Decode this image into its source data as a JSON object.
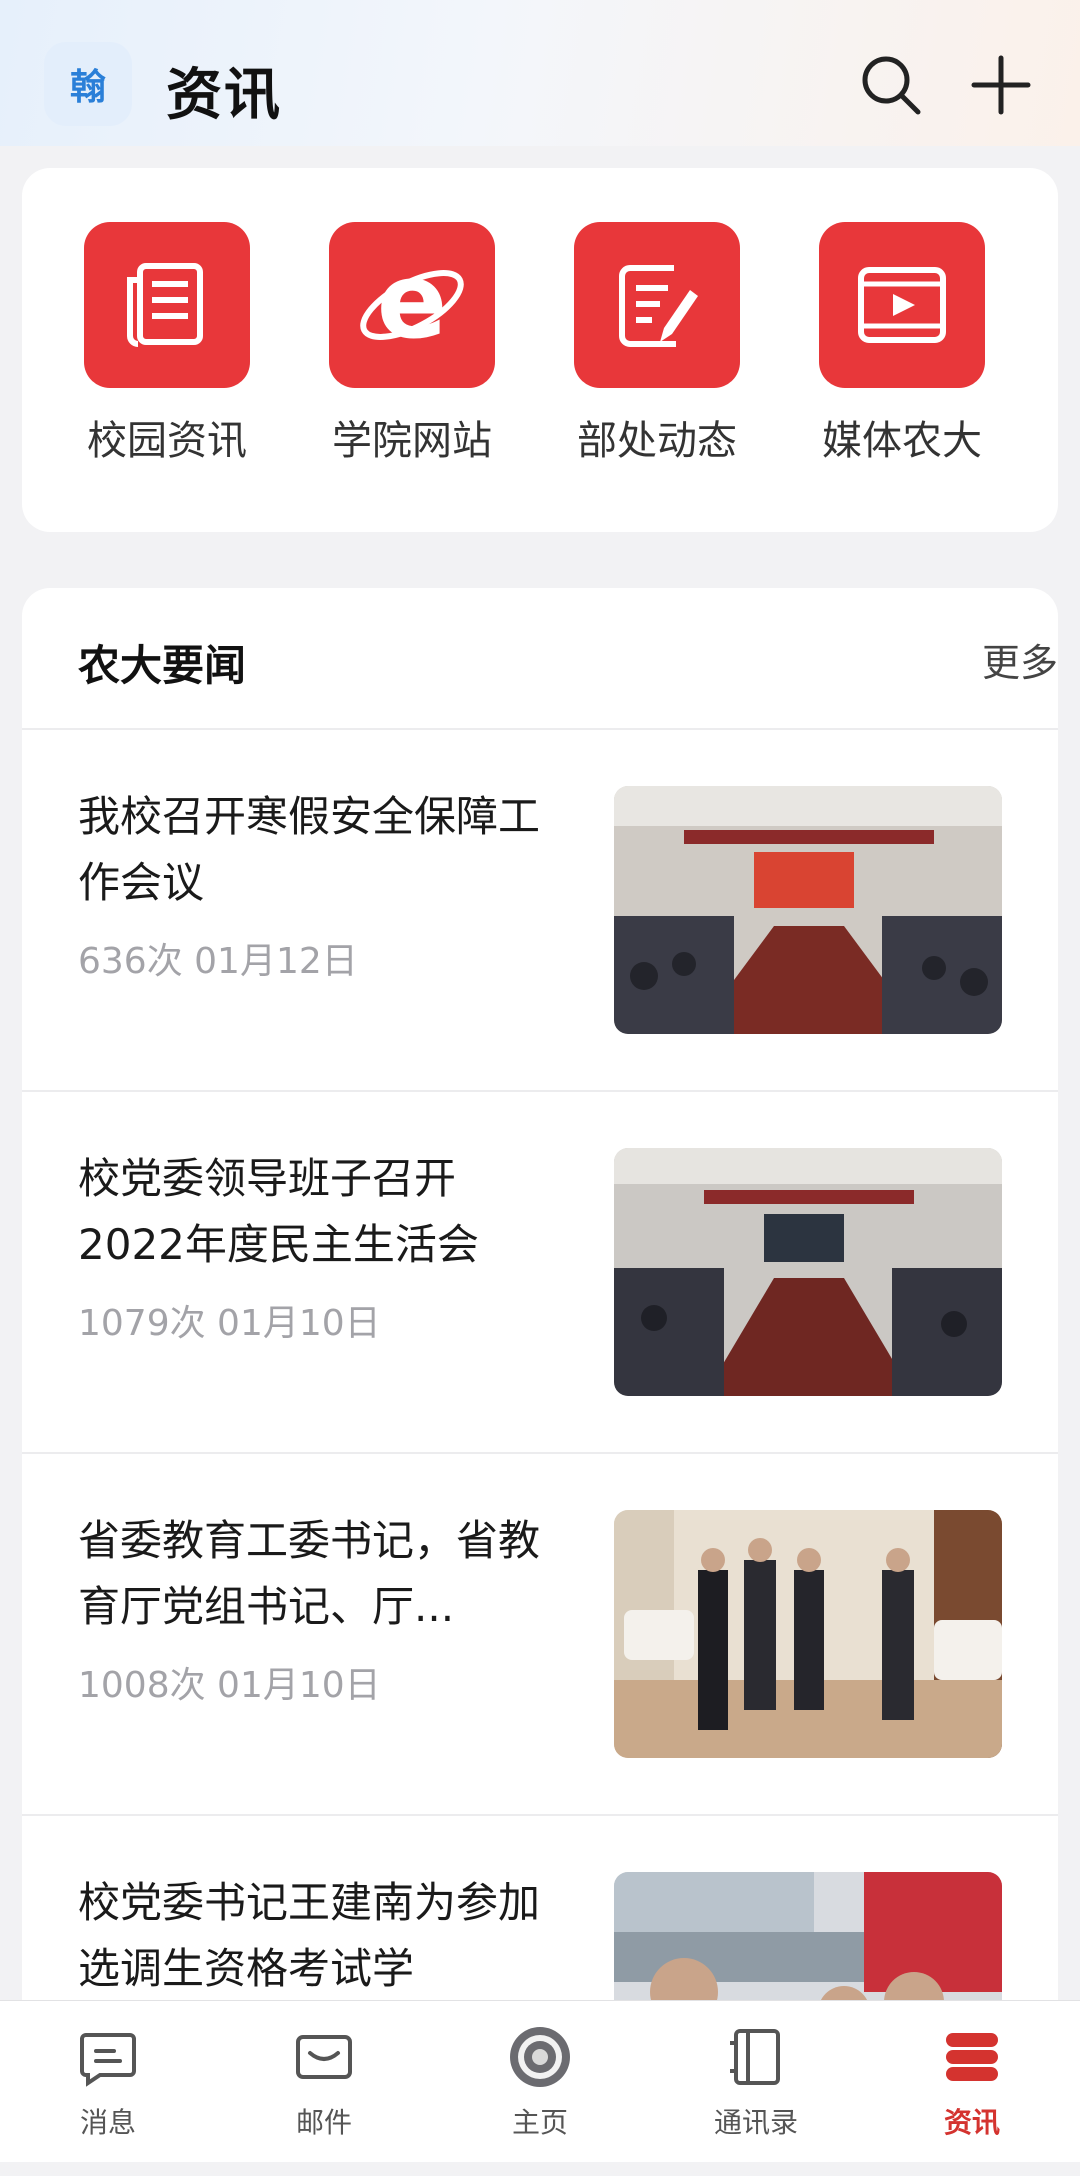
{
  "header": {
    "logo_char": "翰",
    "title": "资讯"
  },
  "quick_links": [
    {
      "label": "校园资讯",
      "icon": "newspaper-icon"
    },
    {
      "label": "学院网站",
      "icon": "browser-e-icon"
    },
    {
      "label": "部处动态",
      "icon": "edit-note-icon"
    },
    {
      "label": "媒体农大",
      "icon": "video-play-icon"
    }
  ],
  "news": {
    "title": "农大要闻",
    "more": "更多",
    "items": [
      {
        "title": "我校召开寒假安全保障工作会议",
        "meta": "636次 01月12日"
      },
      {
        "title": "校党委领导班子召开2022年度民主生活会",
        "meta": "1079次 01月10日"
      },
      {
        "title": "省委教育工委书记，省教育厅党组书记、厅...",
        "meta": "1008次 01月10日"
      },
      {
        "title": "校党委书记王建南为参加选调生资格考试学",
        "meta": ""
      }
    ]
  },
  "tabs": [
    {
      "label": "消息",
      "icon": "message-icon"
    },
    {
      "label": "邮件",
      "icon": "mail-icon"
    },
    {
      "label": "主页",
      "icon": "university-seal-icon"
    },
    {
      "label": "通讯录",
      "icon": "contacts-icon"
    },
    {
      "label": "资讯",
      "icon": "news-stack-icon",
      "active": true
    }
  ],
  "colors": {
    "accent_red": "#e8373a",
    "active_tab": "#d4332f",
    "logo_blue": "#2a7fd8"
  }
}
